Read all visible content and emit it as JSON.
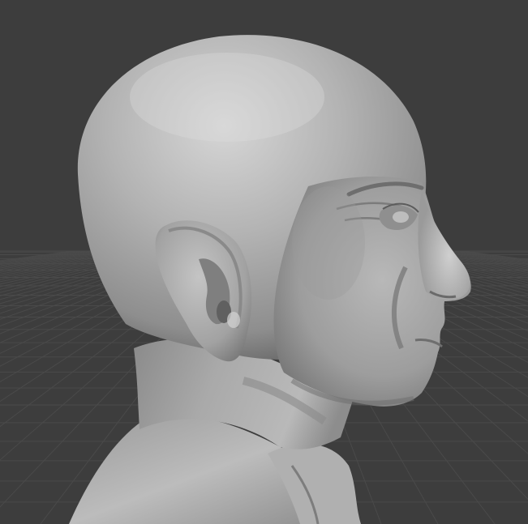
{
  "viewport": {
    "background_color": "#3d3d3d",
    "grid_line_color": "#4a4a4a",
    "model_base_color": "#a6a6a6",
    "model_highlight_color": "#d2d2d2",
    "model_shadow_color": "#5e5e5e",
    "shading": "solid-matcap",
    "view": "perspective-right-side",
    "object": "sculpted-head-bust"
  }
}
